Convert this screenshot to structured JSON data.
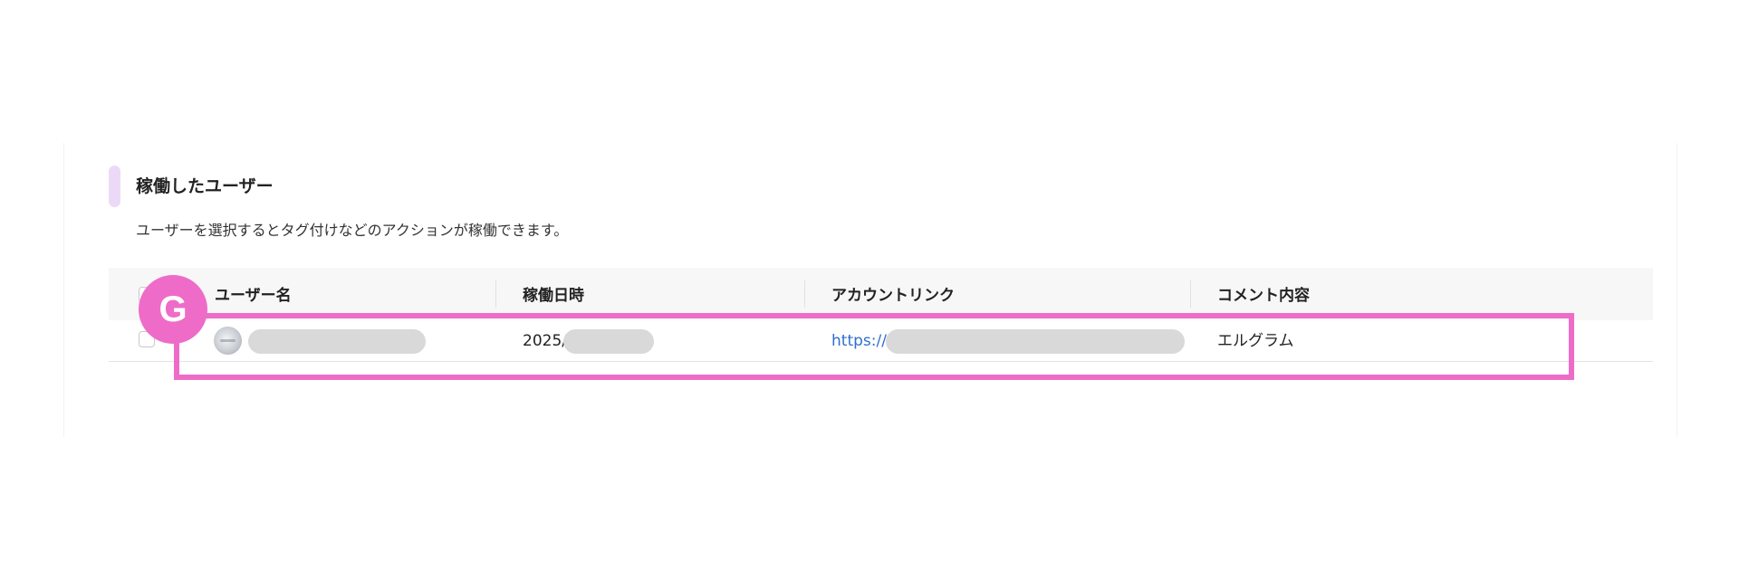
{
  "section": {
    "title": "稼働したユーザー",
    "description": "ユーザーを選択するとタグ付けなどのアクションが稼働できます。"
  },
  "table": {
    "headers": {
      "user_name": "ユーザー名",
      "operated_at": "稼働日時",
      "account_link": "アカウントリンク",
      "comment": "コメント内容"
    },
    "rows": [
      {
        "date_prefix": "2025/",
        "link_prefix": "https://",
        "comment": "エルグラム"
      }
    ]
  },
  "annotation": {
    "badge_label": "G",
    "color": "#ee6cc8"
  },
  "colors": {
    "link": "#2f6fd0",
    "section_accent": "#ecd9f7"
  }
}
